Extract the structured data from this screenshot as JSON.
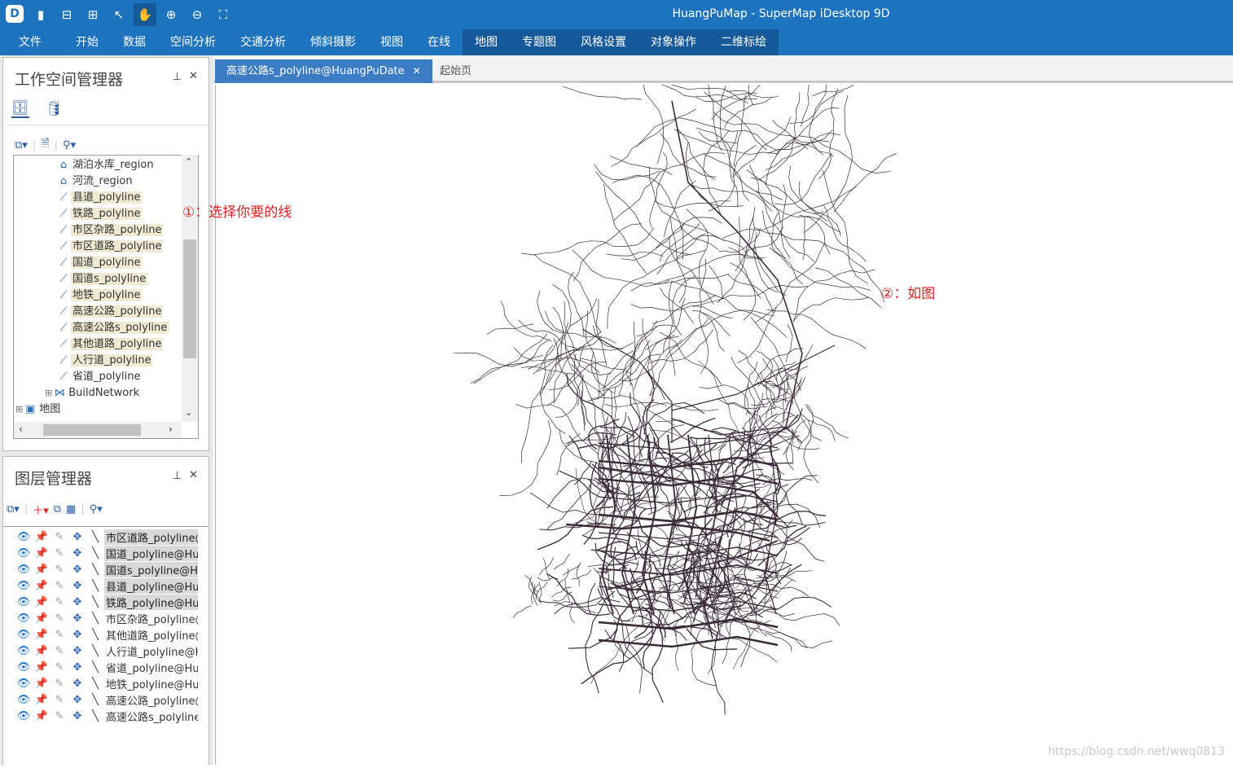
{
  "app": {
    "title": "HuangPuMap - SuperMap iDesktop 9D"
  },
  "menu": [
    "文件",
    "开始",
    "数据",
    "空间分析",
    "交通分析",
    "倾斜摄影",
    "视图",
    "在线",
    "地图",
    "专题图",
    "风格设置",
    "对象操作",
    "二维标绘"
  ],
  "workspace": {
    "title": "工作空间管理器",
    "tree": [
      {
        "label": "湖泊水库_region",
        "icon": "region",
        "hl": false
      },
      {
        "label": "河流_region",
        "icon": "region",
        "hl": false
      },
      {
        "label": "县道_polyline",
        "icon": "line",
        "hl": true
      },
      {
        "label": "铁路_polyline",
        "icon": "line",
        "hl": true
      },
      {
        "label": "市区杂路_polyline",
        "icon": "line",
        "hl": true
      },
      {
        "label": "市区道路_polyline",
        "icon": "line",
        "hl": true
      },
      {
        "label": "国道_polyline",
        "icon": "line",
        "hl": true
      },
      {
        "label": "国道s_polyline",
        "icon": "line",
        "hl": true
      },
      {
        "label": "地铁_polyline",
        "icon": "line",
        "hl": true
      },
      {
        "label": "高速公路_polyline",
        "icon": "line",
        "hl": true
      },
      {
        "label": "高速公路s_polyline",
        "icon": "line",
        "hl": true
      },
      {
        "label": "其他道路_polyline",
        "icon": "line",
        "hl": true
      },
      {
        "label": "人行道_polyline",
        "icon": "line",
        "hl": true
      },
      {
        "label": "省道_polyline",
        "icon": "line",
        "hl": false
      },
      {
        "label": "BuildNetwork",
        "icon": "network",
        "hl": false
      },
      {
        "label": "地图",
        "icon": "map",
        "hl": false
      }
    ]
  },
  "layers": {
    "title": "图层管理器",
    "items": [
      {
        "name": "市区道路_polyline@",
        "sel": true
      },
      {
        "name": "国道_polyline@Hu",
        "sel": true
      },
      {
        "name": "国道s_polyline@Hu",
        "sel": true
      },
      {
        "name": "县道_polyline@Hu",
        "sel": true
      },
      {
        "name": "铁路_polyline@Hu",
        "sel": true
      },
      {
        "name": "市区杂路_polyline@",
        "sel": false
      },
      {
        "name": "其他道路_polyline@",
        "sel": false
      },
      {
        "name": "人行道_polyline@Hu",
        "sel": false
      },
      {
        "name": "省道_polyline@Hu",
        "sel": false
      },
      {
        "name": "地铁_polyline@Hu",
        "sel": false
      },
      {
        "name": "高速公路_polyline@",
        "sel": false
      },
      {
        "name": "高速公路s_polyline",
        "sel": false
      }
    ]
  },
  "tabs": {
    "active": "高速公路s_polyline@HuangPuDate",
    "other": "起始页",
    "close": "✕"
  },
  "annotations": {
    "a1": "①：选择你要的线",
    "a2": "②：如图"
  },
  "watermark": "https://blog.csdn.net/wwq0813",
  "colors": {
    "accent": "#1e73be",
    "road": "#3a2a3a"
  }
}
